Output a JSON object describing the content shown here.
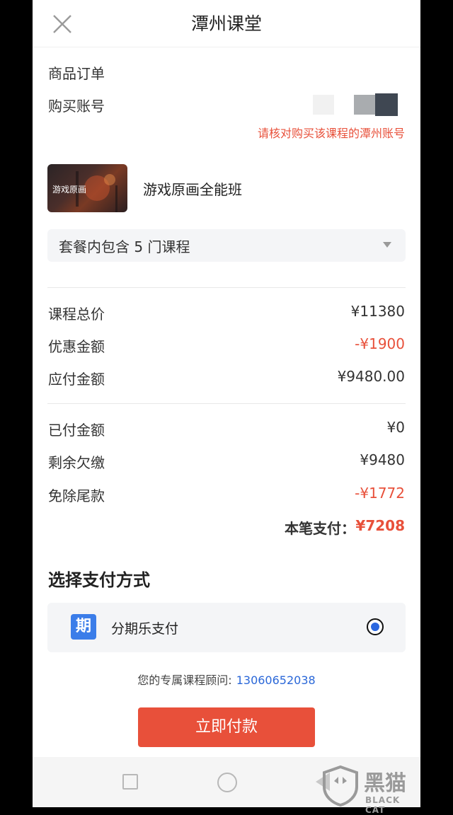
{
  "header": {
    "title": "潭州课堂",
    "close_icon": "close-icon"
  },
  "order": {
    "product_label": "商品订单",
    "account_label": "购买账号",
    "account_warning": "请核对购买该课程的潭州账号"
  },
  "course": {
    "thumb_label": "游戏原画",
    "name": "游戏原画全能班"
  },
  "package": {
    "text": "套餐内包含 5 门课程",
    "caret_icon": "caret-down-icon"
  },
  "prices": {
    "total_label": "课程总价",
    "total_value": "¥11380",
    "discount_label": "优惠金额",
    "discount_value": "-¥1900",
    "payable_label": "应付金额",
    "payable_value": "¥9480.00",
    "paid_label": "已付金额",
    "paid_value": "¥0",
    "remaining_label": "剩余欠缴",
    "remaining_value": "¥9480",
    "waived_label": "免除尾款",
    "waived_value": "-¥1772",
    "this_payment_label": "本笔支付：",
    "this_payment_value": "¥7208"
  },
  "payment": {
    "section_title": "选择支付方式",
    "method_icon_char": "期",
    "method_label": "分期乐支付",
    "selected": true
  },
  "advisor": {
    "label": "您的专属课程顾问:",
    "phone": "13060652038"
  },
  "action": {
    "pay_button": "立即付款"
  },
  "watermark": {
    "cn": "黑猫",
    "en": "BLACK CAT"
  },
  "colors": {
    "accent_red": "#e8503a",
    "link_blue": "#2a67d8",
    "method_blue": "#3b7de9"
  }
}
